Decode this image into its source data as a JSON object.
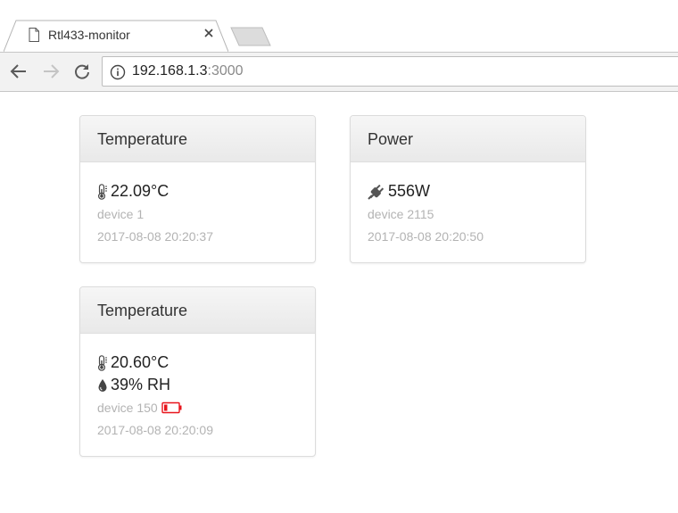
{
  "browser": {
    "tab_title": "Rtl433-monitor",
    "url_host": "192.168.1.3",
    "url_port": ":3000"
  },
  "cards": [
    {
      "title": "Temperature",
      "readings": [
        {
          "icon": "thermometer-icon",
          "value": "22.09°C"
        }
      ],
      "device": "device 1",
      "timestamp": "2017-08-08 20:20:37"
    },
    {
      "title": "Power",
      "readings": [
        {
          "icon": "plug-icon",
          "value": "556W"
        }
      ],
      "device": "device 2115",
      "timestamp": "2017-08-08 20:20:50"
    },
    {
      "title": "Temperature",
      "readings": [
        {
          "icon": "thermometer-icon",
          "value": "20.60°C"
        },
        {
          "icon": "droplet-icon",
          "value": "39% RH"
        }
      ],
      "device": "device 150",
      "battery_icon": "battery-low-icon",
      "timestamp": "2017-08-08 20:20:09"
    }
  ],
  "colors": {
    "battery_low": "#e8141c",
    "meta_text": "#b3b3b3"
  }
}
